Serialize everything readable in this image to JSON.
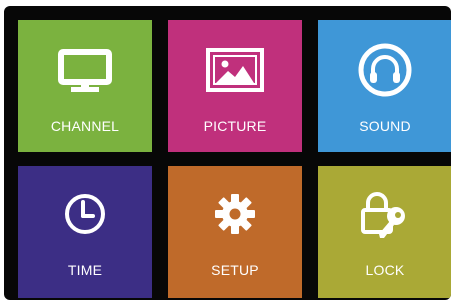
{
  "menu": {
    "tiles": [
      {
        "label": "CHANNEL",
        "icon": "tv-icon",
        "color": "#7bb23f"
      },
      {
        "label": "PICTURE",
        "icon": "picture-icon",
        "color": "#c0307c"
      },
      {
        "label": "SOUND",
        "icon": "headphones-icon",
        "color": "#3f97d7"
      },
      {
        "label": "TIME",
        "icon": "clock-icon",
        "color": "#3c2e85"
      },
      {
        "label": "SETUP",
        "icon": "gear-icon",
        "color": "#bf6a2a"
      },
      {
        "label": "LOCK",
        "icon": "lock-key-icon",
        "color": "#aaa936"
      }
    ]
  },
  "colors": {
    "frame": "#070707",
    "label_text": "#ffffff"
  }
}
